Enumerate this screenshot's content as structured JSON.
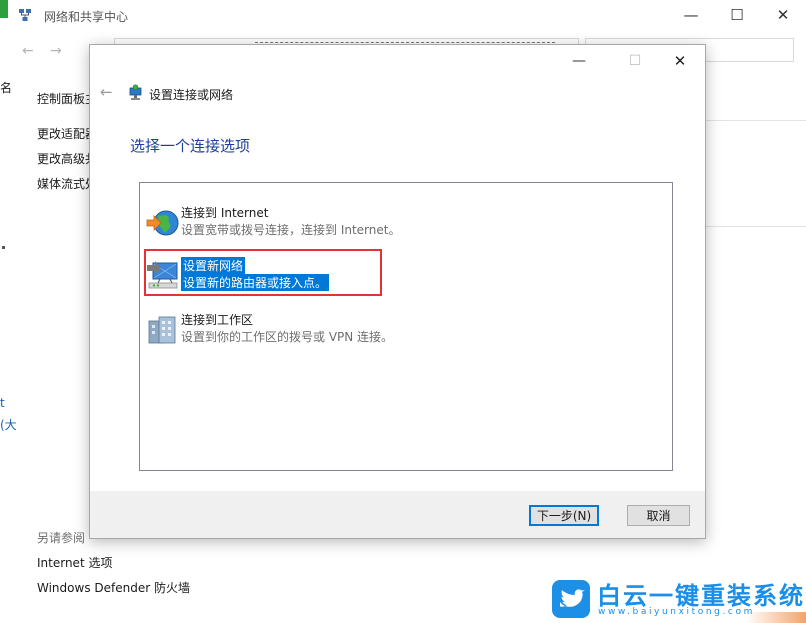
{
  "background_window": {
    "title": "网络和共享中心",
    "window_controls": {
      "minimize": "—",
      "maximize": "☐",
      "close": "✕"
    },
    "nav": {
      "back": "←",
      "forward": "→"
    },
    "sidebar": {
      "edge_cut_1": "名",
      "control_panel_home": "控制面板主",
      "links": [
        "更改适配器",
        "更改高级共",
        "媒体流式处"
      ],
      "edge_cut_2": "t",
      "edge_cut_3": "(大",
      "see_also_heading": "另请参阅",
      "see_also_links": [
        "Internet 选项",
        "Windows Defender 防火墙"
      ]
    }
  },
  "dialog": {
    "window_controls": {
      "minimize": "—",
      "maximize": "☐",
      "close": "✕"
    },
    "back": "←",
    "title": "设置连接或网络",
    "heading": "选择一个连接选项",
    "options": [
      {
        "title": "连接到 Internet",
        "desc": "设置宽带或拨号连接，连接到 Internet。",
        "icon": "globe-connect-icon",
        "selected": false
      },
      {
        "title": "设置新网络",
        "desc": "设置新的路由器或接入点。",
        "icon": "router-network-icon",
        "selected": true
      },
      {
        "title": "连接到工作区",
        "desc": "设置到你的工作区的拨号或 VPN 连接。",
        "icon": "workplace-building-icon",
        "selected": false
      }
    ],
    "buttons": {
      "next": "下一步(N)",
      "cancel": "取消"
    }
  },
  "watermark": {
    "brand": "白云一键重装系统",
    "url": "www.baiyunxitong.com",
    "logo_color": "#1d8fe6"
  },
  "colors": {
    "selection": "#0078d7",
    "heading": "#1e3f9e",
    "highlight_outline": "#e23434"
  }
}
